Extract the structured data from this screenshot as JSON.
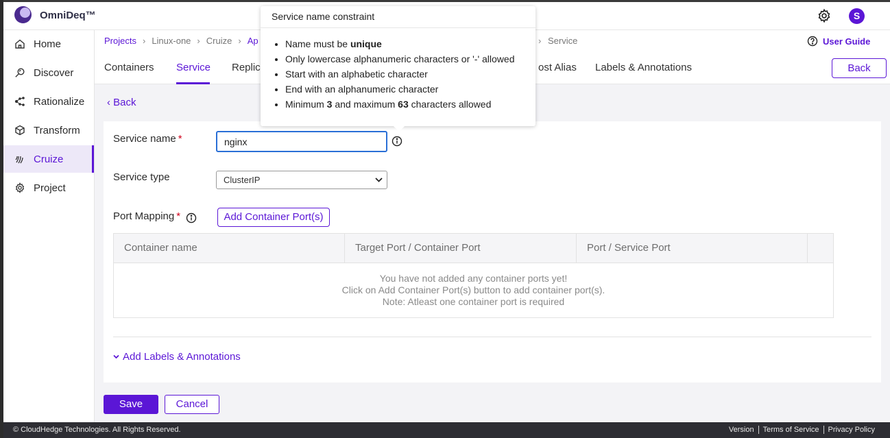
{
  "app": {
    "brand": "OmniDeq™",
    "avatar_initial": "S"
  },
  "sidebar": {
    "items": [
      {
        "label": "Home",
        "icon": "home-icon"
      },
      {
        "label": "Discover",
        "icon": "discover-icon"
      },
      {
        "label": "Rationalize",
        "icon": "rationalize-icon"
      },
      {
        "label": "Transform",
        "icon": "transform-icon"
      },
      {
        "label": "Cruize",
        "icon": "cruize-icon",
        "active": true
      },
      {
        "label": "Project",
        "icon": "project-gear-icon"
      }
    ]
  },
  "breadcrumb": {
    "items": [
      "Projects",
      "Linux-one",
      "Cruize",
      "Ap"
    ],
    "last": "Service"
  },
  "user_guide": "User Guide",
  "tabs": {
    "items": [
      "Containers",
      "Service",
      "Replica",
      "ost Alias",
      "Labels & Annotations"
    ],
    "active": "Service"
  },
  "back_button": "Back",
  "back_link": "Back",
  "form": {
    "service_name_label": "Service name",
    "service_name_value": "nginx",
    "required_mark": "*",
    "service_type_label": "Service type",
    "service_type_value": "ClusterIP",
    "port_mapping_label": "Port Mapping",
    "add_port_button": "Add Container Port(s)"
  },
  "table": {
    "columns": [
      "Container name",
      "Target Port / Container Port",
      "Port / Service Port"
    ],
    "empty_lines": [
      "You have not added any container ports yet!",
      "Click on Add Container Port(s) button to add container port(s).",
      "Note: Atleast one container port is required"
    ]
  },
  "labels_toggle": "Add Labels & Annotations",
  "actions": {
    "save": "Save",
    "cancel": "Cancel"
  },
  "tooltip": {
    "title": "Service name constraint",
    "items": [
      {
        "before": "Name must be ",
        "bold": "unique",
        "after": ""
      },
      {
        "before": "Only lowercase alphanumeric characters or '-' allowed",
        "bold": "",
        "after": ""
      },
      {
        "before": "Start with an alphabetic character",
        "bold": "",
        "after": ""
      },
      {
        "before": "End with an alphanumeric character",
        "bold": "",
        "after": ""
      },
      {
        "before": "Minimum ",
        "bold": "3",
        "mid": " and maximum ",
        "bold2": "63",
        "after": " characters allowed"
      }
    ]
  },
  "footer": {
    "copyright": "© CloudHedge Technologies. All Rights Reserved.",
    "links": [
      "Version",
      "Terms of Service",
      "Privacy Policy"
    ]
  },
  "colors": {
    "accent": "#5b16d6",
    "required": "#d0021b",
    "footer_bg": "#2d2d33"
  }
}
